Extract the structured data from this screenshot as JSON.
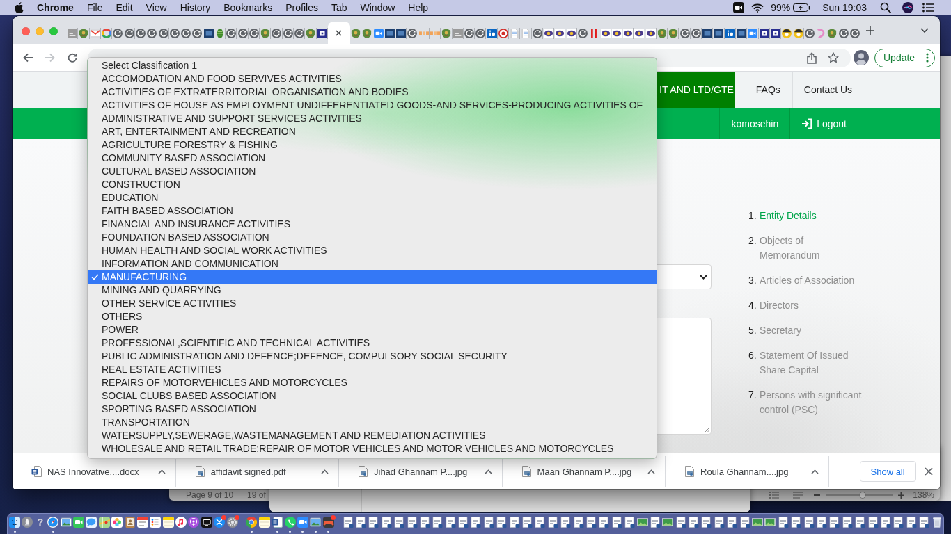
{
  "menu_bar": {
    "menus": [
      {
        "kind": "app",
        "label": "Chrome"
      },
      {
        "kind": "menu",
        "label": "File"
      },
      {
        "kind": "menu",
        "label": "Edit"
      },
      {
        "kind": "menu",
        "label": "View"
      },
      {
        "kind": "menu",
        "label": "History"
      },
      {
        "kind": "menu",
        "label": "Bookmarks"
      },
      {
        "kind": "menu",
        "label": "Profiles"
      },
      {
        "kind": "menu",
        "label": "Tab"
      },
      {
        "kind": "menu",
        "label": "Window"
      },
      {
        "kind": "menu",
        "label": "Help"
      }
    ],
    "battery": "99%",
    "clock": "Sun 19:03"
  },
  "browser": {
    "tabs": [
      {
        "kind": "grey-tile",
        "selected": false
      },
      {
        "kind": "emblem",
        "selected": false
      },
      {
        "kind": "envelope",
        "selected": false
      },
      {
        "kind": "ring",
        "selected": false
      },
      {
        "kind": "default",
        "selected": false
      },
      {
        "kind": "default",
        "selected": false
      },
      {
        "kind": "default",
        "selected": false
      },
      {
        "kind": "default",
        "selected": false
      },
      {
        "kind": "default",
        "selected": false
      },
      {
        "kind": "default",
        "selected": false
      },
      {
        "kind": "default",
        "selected": false
      },
      {
        "kind": "default",
        "selected": false
      },
      {
        "kind": "navy-tile",
        "selected": false
      },
      {
        "kind": "leaf",
        "selected": false
      },
      {
        "kind": "default",
        "selected": false
      },
      {
        "kind": "default",
        "selected": false
      },
      {
        "kind": "default",
        "selected": false
      },
      {
        "kind": "emblem",
        "selected": false
      },
      {
        "kind": "default",
        "selected": false
      },
      {
        "kind": "default",
        "selected": false
      },
      {
        "kind": "default",
        "selected": false
      },
      {
        "kind": "emblem",
        "selected": false
      },
      {
        "kind": "letter-tile",
        "selected": false
      },
      {
        "selected": true
      },
      {
        "kind": "emblem",
        "selected": false
      },
      {
        "kind": "emblem",
        "selected": false
      },
      {
        "kind": "video",
        "selected": false
      },
      {
        "kind": "navy-tile",
        "selected": false
      },
      {
        "kind": "navy-tile",
        "selected": false
      },
      {
        "kind": "default",
        "selected": false
      },
      {
        "kind": "stripes",
        "selected": false
      },
      {
        "kind": "stripes",
        "selected": false
      },
      {
        "kind": "emblem",
        "selected": false
      },
      {
        "kind": "grey-tile",
        "selected": false
      },
      {
        "kind": "default",
        "selected": false
      },
      {
        "kind": "default",
        "selected": false
      },
      {
        "kind": "blue-tile",
        "selected": false
      },
      {
        "kind": "seal",
        "selected": false
      },
      {
        "kind": "page",
        "selected": false
      },
      {
        "kind": "page",
        "selected": false
      },
      {
        "kind": "default",
        "selected": false
      },
      {
        "kind": "eye",
        "selected": false
      },
      {
        "kind": "eye",
        "selected": false
      },
      {
        "kind": "eye",
        "selected": false
      },
      {
        "kind": "default",
        "selected": false
      },
      {
        "kind": "bars",
        "selected": false
      },
      {
        "kind": "eye",
        "selected": false
      },
      {
        "kind": "eye",
        "selected": false
      },
      {
        "kind": "eye",
        "selected": false
      },
      {
        "kind": "eye",
        "selected": false
      },
      {
        "kind": "eye",
        "selected": false
      },
      {
        "kind": "emblem",
        "selected": false
      },
      {
        "kind": "emblem",
        "selected": false
      },
      {
        "kind": "default",
        "selected": false
      },
      {
        "kind": "default",
        "selected": false
      },
      {
        "kind": "navy-tile",
        "selected": false
      },
      {
        "kind": "navy-tile",
        "selected": false
      },
      {
        "kind": "blue-tile",
        "selected": false
      },
      {
        "kind": "navy-tile",
        "selected": false
      },
      {
        "kind": "video",
        "selected": false
      },
      {
        "kind": "letter-tile",
        "selected": false
      },
      {
        "kind": "letter-tile",
        "selected": false
      },
      {
        "kind": "disc",
        "selected": false
      },
      {
        "kind": "disc",
        "selected": false
      },
      {
        "kind": "default",
        "selected": false
      },
      {
        "kind": "swirl",
        "selected": false
      },
      {
        "kind": "emblem",
        "selected": false
      },
      {
        "kind": "default",
        "selected": false
      },
      {
        "kind": "default",
        "selected": false
      }
    ],
    "toolbar": {
      "buttons": [
        {
          "kind": "back",
          "disabled": false
        },
        {
          "kind": "forward",
          "disabled": true
        },
        {
          "kind": "reload",
          "disabled": false
        }
      ],
      "update_button": "Update"
    }
  },
  "page": {
    "nav": [
      {
        "label": "IT AND LTD/GTE",
        "selected": true
      },
      {
        "label": "FAQs",
        "selected": false
      },
      {
        "label": "Contact Us",
        "selected": false
      }
    ],
    "user_bar": {
      "username": "komosehin",
      "logout": "Logout"
    },
    "steps": [
      {
        "number": "1.",
        "label": "Entity Details",
        "selected": true
      },
      {
        "number": "2.",
        "label": "Objects of Memorandum",
        "selected": false
      },
      {
        "number": "3.",
        "label": "Articles of Association",
        "selected": false
      },
      {
        "number": "4.",
        "label": "Directors",
        "selected": false
      },
      {
        "number": "5.",
        "label": "Secretary",
        "selected": false
      },
      {
        "number": "6.",
        "label": "Statement Of Issued Share Capital",
        "selected": false
      },
      {
        "number": "7.",
        "label": "Persons with significant control (PSC)",
        "selected": false
      }
    ]
  },
  "select_popup": {
    "options": [
      {
        "label": "Select Classification 1",
        "selected": false
      },
      {
        "label": "ACCOMODATION AND FOOD SERVIVES ACTIVITIES",
        "selected": false
      },
      {
        "label": "ACTIVITIES OF EXTRATERRITORIAL ORGANISATION AND BODIES",
        "selected": false
      },
      {
        "label": "ACTIVITIES OF HOUSE AS EMPLOYMENT UNDIFFERENTIATED GOODS-AND SERVICES-PRODUCING ACTIVITIES OF",
        "selected": false
      },
      {
        "label": "ADMINISTRATIVE AND SUPPORT SERVICES ACTIVITIES",
        "selected": false
      },
      {
        "label": "ART, ENTERTAINMENT AND RECREATION",
        "selected": false
      },
      {
        "label": "AGRICULTURE FORESTRY & FISHING",
        "selected": false
      },
      {
        "label": "COMMUNITY BASED ASSOCIATION",
        "selected": false
      },
      {
        "label": "CULTURAL BASED ASSOCIATION",
        "selected": false
      },
      {
        "label": "CONSTRUCTION",
        "selected": false
      },
      {
        "label": "EDUCATION",
        "selected": false
      },
      {
        "label": "FAITH BASED ASSOCIATION",
        "selected": false
      },
      {
        "label": "FINANCIAL AND INSURANCE ACTIVITIES",
        "selected": false
      },
      {
        "label": "FOUNDATION BASED ASSOCIATION",
        "selected": false
      },
      {
        "label": "HUMAN HEALTH AND SOCIAL WORK ACTIVITIES",
        "selected": false
      },
      {
        "label": "INFORMATION AND COMMUNICATION",
        "selected": false
      },
      {
        "label": "MANUFACTURING",
        "selected": true
      },
      {
        "label": "MINING AND QUARRYING",
        "selected": false
      },
      {
        "label": "OTHER SERVICE ACTIVITIES",
        "selected": false
      },
      {
        "label": "OTHERS",
        "selected": false
      },
      {
        "label": "POWER",
        "selected": false
      },
      {
        "label": "PROFESSIONAL,SCIENTIFIC AND TECHNICAL ACTIVITIES",
        "selected": false
      },
      {
        "label": "PUBLIC ADMINISTRATION AND DEFENCE;DEFENCE, COMPULSORY SOCIAL SECURITY",
        "selected": false
      },
      {
        "label": "REAL ESTATE ACTIVITIES",
        "selected": false
      },
      {
        "label": "REPAIRS OF MOTORVEHICLES AND MOTORCYCLES",
        "selected": false
      },
      {
        "label": "SOCIAL CLUBS BASED ASSOCIATION",
        "selected": false
      },
      {
        "label": "SPORTING BASED ASSOCIATION",
        "selected": false
      },
      {
        "label": "TRANSPORTATION",
        "selected": false
      },
      {
        "label": "WATERSUPPLY,SEWERAGE,WASTEMANAGEMENT AND REMEDIATION ACTIVITIES",
        "selected": false
      },
      {
        "label": "WHOLESALE AND RETAIL TRADE;REPAIR OF MOTOR VEHICLES AND MOTOR VEHICLES AND MOTORCYCLES",
        "selected": false
      }
    ]
  },
  "downloads": {
    "items": [
      {
        "kind": "word",
        "name": "NAS Innovative....docx"
      },
      {
        "kind": "preview",
        "name": "affidavit signed.pdf"
      },
      {
        "kind": "preview",
        "name": "Jihad Ghannam P....jpg"
      },
      {
        "kind": "preview",
        "name": "Maan Ghannam P....jpg"
      },
      {
        "kind": "preview",
        "name": "Roula Ghannam....jpg"
      }
    ],
    "show_all": "Show all"
  },
  "background_window": {
    "page_count": "Page 9 of 10",
    "word_count": "19 of",
    "zoom_slider": {
      "level": 0.55
    },
    "zoom": "138%"
  },
  "dock": {
    "pinned": [
      {
        "kind": "finder",
        "running": true,
        "badge": false
      },
      {
        "kind": "rocket",
        "running": false,
        "badge": false
      },
      {
        "kind": "unknown",
        "glyph": "?",
        "running": false,
        "badge": false
      },
      {
        "kind": "compass",
        "running": true,
        "badge": false
      },
      {
        "kind": "picture",
        "running": false,
        "badge": false
      },
      {
        "kind": "video-call",
        "running": false,
        "badge": false
      },
      {
        "kind": "chat",
        "running": false,
        "badge": false
      },
      {
        "kind": "map",
        "running": false,
        "badge": false
      },
      {
        "kind": "flower",
        "running": false,
        "badge": false
      },
      {
        "kind": "contacts",
        "running": false,
        "badge": false
      },
      {
        "kind": "calendar",
        "running": false,
        "badge": false
      },
      {
        "kind": "checklist",
        "running": false,
        "badge": false
      },
      {
        "kind": "notes",
        "running": false,
        "badge": false
      },
      {
        "kind": "music",
        "running": false,
        "badge": false
      },
      {
        "kind": "podcast",
        "running": false,
        "badge": false
      },
      {
        "kind": "tv",
        "running": false,
        "badge": false
      },
      {
        "kind": "store",
        "running": false,
        "badge": true
      },
      {
        "kind": "gear",
        "running": false,
        "badge": true
      }
    ],
    "recent": [
      {
        "kind": "chrome",
        "running": true,
        "badge": false
      },
      {
        "kind": "notes",
        "running": false,
        "badge": false
      },
      {
        "kind": "word",
        "running": true,
        "badge": false
      },
      {
        "kind": "phone-chat",
        "running": true,
        "badge": false
      },
      {
        "kind": "video",
        "running": true,
        "badge": false
      },
      {
        "kind": "picture",
        "running": true,
        "badge": false
      },
      {
        "kind": "gamepad",
        "running": true,
        "badge": true
      }
    ],
    "minimized": [
      {
        "kind": "document"
      },
      {
        "kind": "document"
      },
      {
        "kind": "document"
      },
      {
        "kind": "document"
      },
      {
        "kind": "document"
      },
      {
        "kind": "document"
      },
      {
        "kind": "document"
      },
      {
        "kind": "document"
      },
      {
        "kind": "document"
      },
      {
        "kind": "document"
      },
      {
        "kind": "document"
      },
      {
        "kind": "document"
      },
      {
        "kind": "document"
      },
      {
        "kind": "document"
      },
      {
        "kind": "document"
      },
      {
        "kind": "document"
      },
      {
        "kind": "document"
      },
      {
        "kind": "document"
      },
      {
        "kind": "document"
      },
      {
        "kind": "document"
      },
      {
        "kind": "document"
      },
      {
        "kind": "document"
      },
      {
        "kind": "document"
      },
      {
        "kind": "image"
      },
      {
        "kind": "document"
      },
      {
        "kind": "image"
      },
      {
        "kind": "document"
      },
      {
        "kind": "document"
      },
      {
        "kind": "document"
      },
      {
        "kind": "document"
      },
      {
        "kind": "document"
      },
      {
        "kind": "document"
      },
      {
        "kind": "image"
      },
      {
        "kind": "image"
      },
      {
        "kind": "document"
      },
      {
        "kind": "document"
      },
      {
        "kind": "document"
      },
      {
        "kind": "document"
      },
      {
        "kind": "document"
      },
      {
        "kind": "document"
      },
      {
        "kind": "document"
      },
      {
        "kind": "document"
      },
      {
        "kind": "document"
      },
      {
        "kind": "document"
      },
      {
        "kind": "document"
      },
      {
        "kind": "document"
      }
    ]
  }
}
